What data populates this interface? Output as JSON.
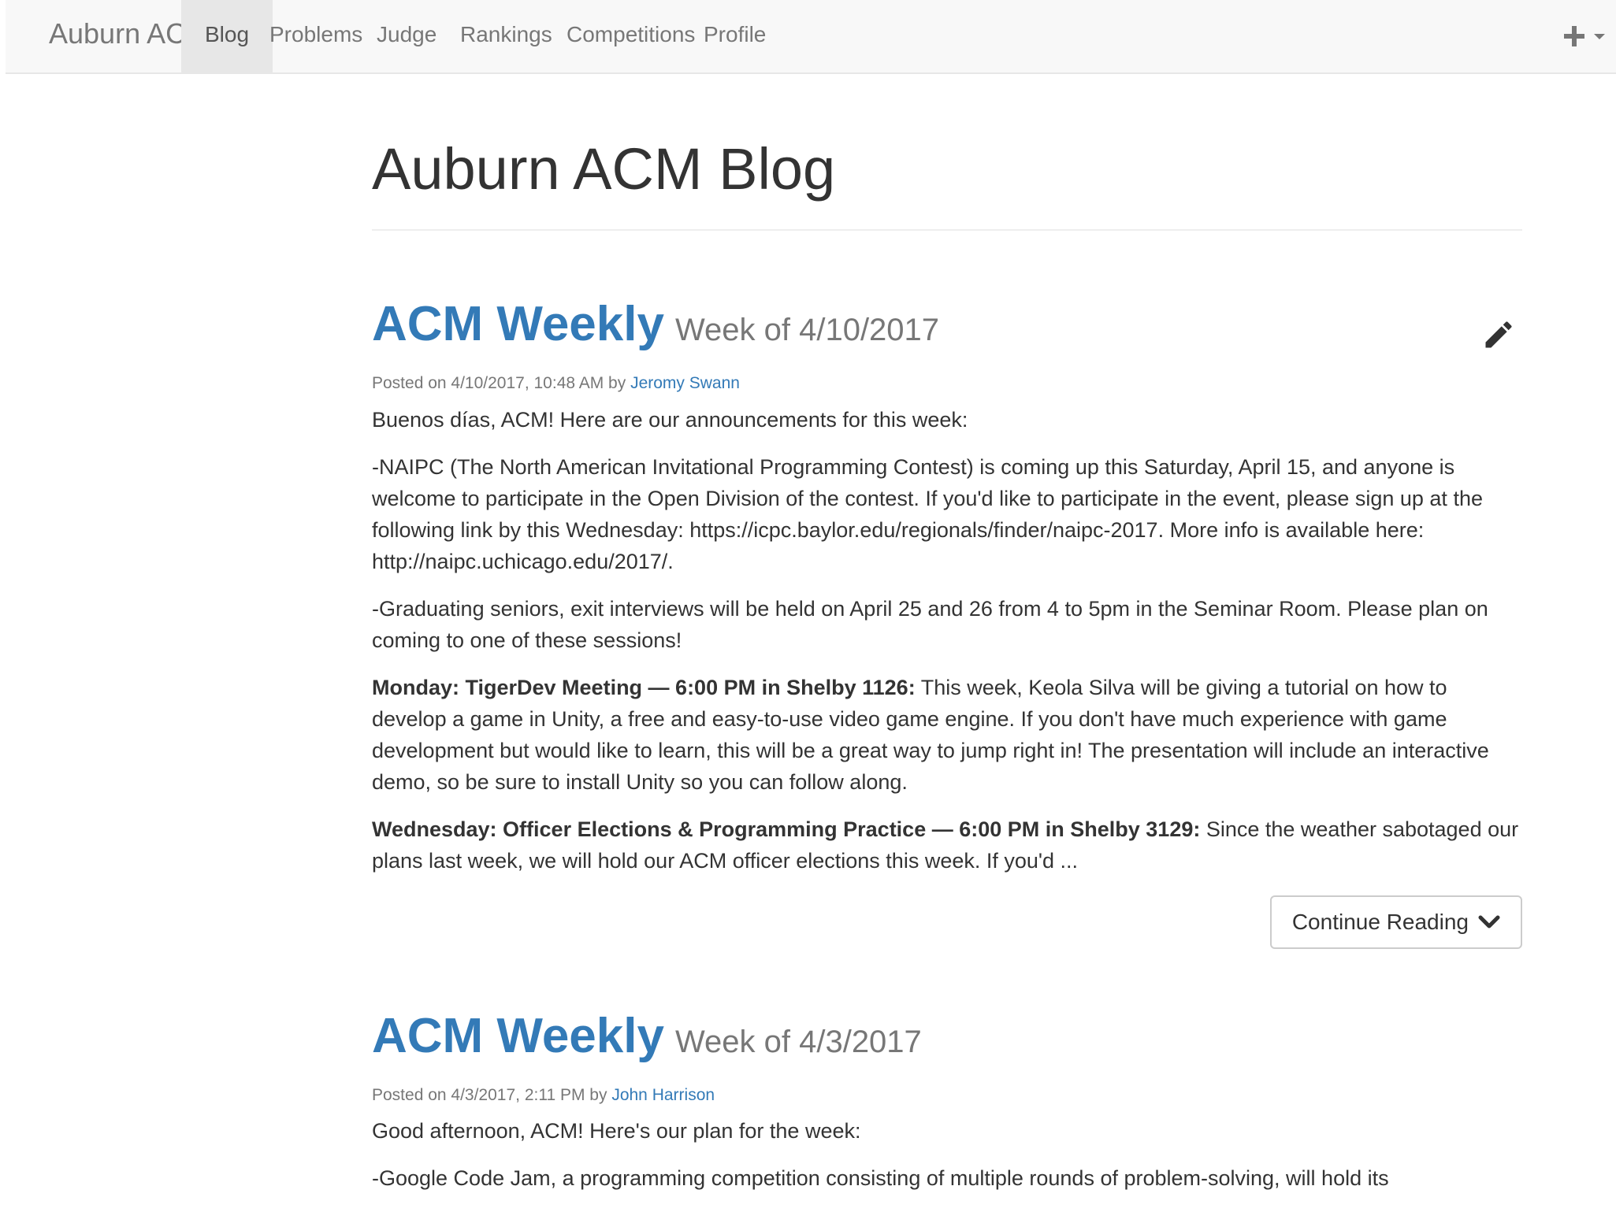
{
  "navbar": {
    "brand": "Auburn ACM",
    "items": [
      {
        "label": "Blog",
        "active": true
      },
      {
        "label": "Problems",
        "active": false
      },
      {
        "label": "Judge",
        "active": false
      },
      {
        "label": "Rankings",
        "active": false
      },
      {
        "label": "Competitions",
        "active": false
      },
      {
        "label": "Profile",
        "active": false
      }
    ],
    "plus_icon": "plus-icon",
    "caret_icon": "caret-down-icon"
  },
  "page": {
    "title": "Auburn ACM Blog"
  },
  "posts": [
    {
      "title": "ACM Weekly",
      "subtitle": "Week of 4/10/2017",
      "meta_prefix": "Posted on 4/10/2017, 10:48 AM by ",
      "author": "Jeromy Swann",
      "edit_icon": "pencil-icon",
      "paragraphs": [
        "Buenos días, ACM! Here are our announcements for this week:",
        "-NAIPC (The North American Invitational Programming Contest) is coming up this Saturday, April 15, and anyone is welcome to participate in the Open Division of the contest. If you'd like to participate in the event, please sign up at the following link by this Wednesday: https://icpc.baylor.edu/regionals/finder/naipc-2017. More info is available here: http://naipc.uchicago.edu/2017/.",
        "-Graduating seniors, exit interviews will be held on April 25 and 26 from 4 to 5pm in the Seminar Room. Please plan on coming to one of these sessions!"
      ],
      "monday_bold": "Monday: TigerDev Meeting — 6:00 PM in Shelby 1126:",
      "monday_text": " This week, Keola Silva will be giving a tutorial on how to develop a game in Unity, a free and easy-to-use video game engine. If you don't have much experience with game development but would like to learn, this will be a great way to jump right in! The presentation will include an interactive demo, so be sure to install Unity so you can follow along.",
      "wednesday_bold": "Wednesday: Officer Elections & Programming Practice — 6:00 PM in Shelby 3129:",
      "wednesday_text": " Since the weather sabotaged our plans last week, we will hold our ACM officer elections this week. If you'd ...",
      "continue_label": "Continue Reading",
      "continue_icon": "chevron-down-icon"
    },
    {
      "title": "ACM Weekly",
      "subtitle": "Week of 4/3/2017",
      "meta_prefix": "Posted on 4/3/2017, 2:11 PM by ",
      "author": "John Harrison",
      "paragraphs": [
        "Good afternoon, ACM! Here's our plan for the week:",
        "-Google Code Jam, a programming competition consisting of multiple rounds of problem-solving, will hold its"
      ]
    }
  ]
}
